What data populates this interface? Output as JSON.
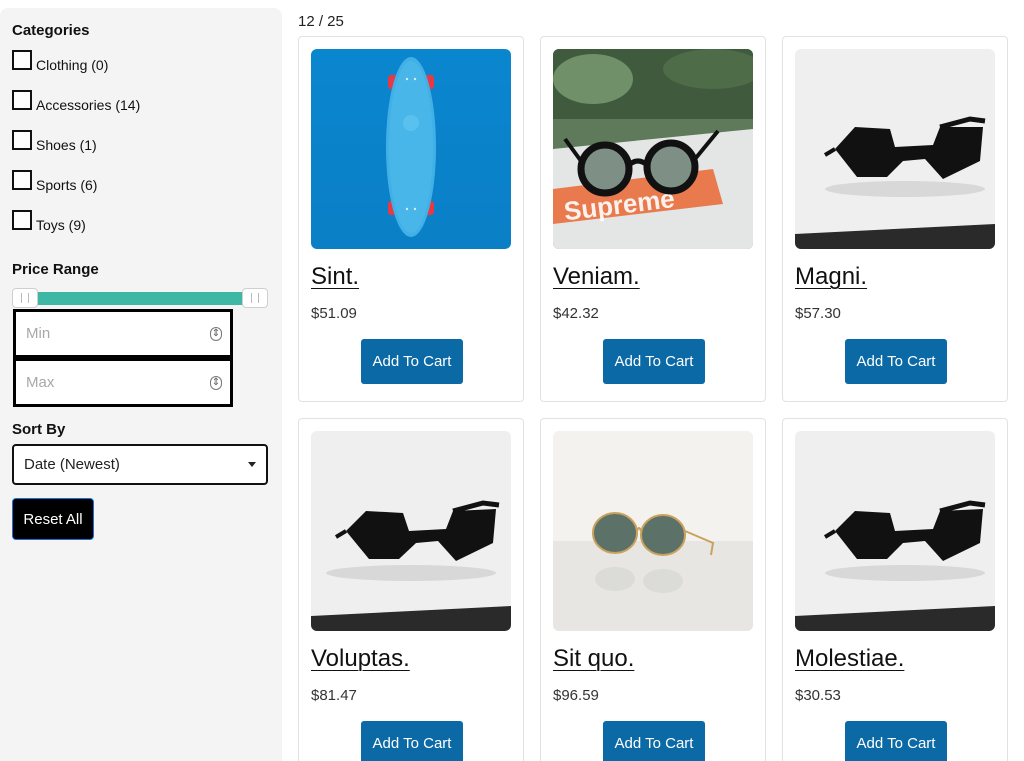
{
  "sidebar": {
    "categories_title": "Categories",
    "categories": [
      {
        "label": "Clothing (0)"
      },
      {
        "label": "Accessories (14)"
      },
      {
        "label": "Shoes (1)"
      },
      {
        "label": "Sports (6)"
      },
      {
        "label": "Toys (9)"
      }
    ],
    "price_title": "Price Range",
    "min_placeholder": "Min",
    "max_placeholder": "Max",
    "sort_title": "Sort By",
    "sort_selected": "Date (Newest)",
    "reset_label": "Reset All"
  },
  "main": {
    "count": "12 / 25",
    "products": [
      {
        "name": "Sint.",
        "price": "$51.09",
        "cart_label": "Add To Cart",
        "image": "skateboard"
      },
      {
        "name": "Veniam.",
        "price": "$42.32",
        "cart_label": "Add To Cart",
        "image": "round-sunglasses"
      },
      {
        "name": "Magni.",
        "price": "$57.30",
        "cart_label": "Add To Cart",
        "image": "black-sunglasses"
      },
      {
        "name": "Voluptas.",
        "price": "$81.47",
        "cart_label": "Add To Cart",
        "image": "black-sunglasses"
      },
      {
        "name": "Sit quo.",
        "price": "$96.59",
        "cart_label": "Add To Cart",
        "image": "gold-sunglasses"
      },
      {
        "name": "Molestiae.",
        "price": "$30.53",
        "cart_label": "Add To Cart",
        "image": "black-sunglasses"
      }
    ]
  },
  "colors": {
    "slider": "#3eb8a4",
    "button": "#0b6aa5",
    "sidebar_bg": "#f4f4f4"
  }
}
